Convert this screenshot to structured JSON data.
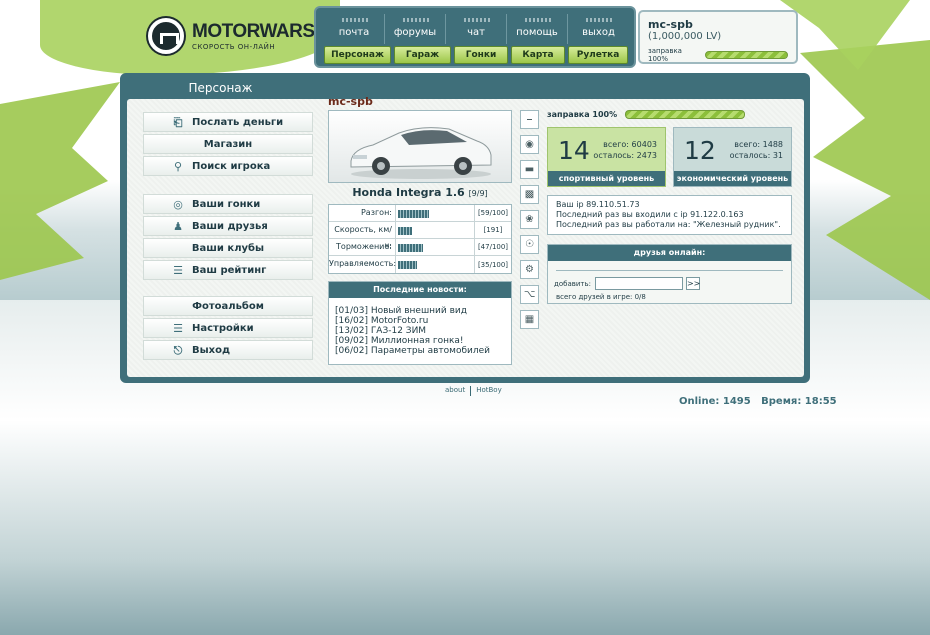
{
  "logo": {
    "title": "MOTORWARS.RU",
    "subtitle": "СКОРОСТЬ ОН-ЛАЙН"
  },
  "nav": {
    "top": [
      "почта",
      "форумы",
      "чат",
      "помощь",
      "выход"
    ],
    "bottom": [
      "Персонаж",
      "Гараж",
      "Гонки",
      "Карта",
      "Рулетка"
    ]
  },
  "user": {
    "name": "mc-spb",
    "lv": "(1,000,000 LV)",
    "fuel_label": "заправка 100%",
    "fuel_pct": 100
  },
  "section_tab": "Персонаж",
  "sidebar": {
    "group1": [
      {
        "label": "Послать деньги",
        "icon": "money-icon"
      },
      {
        "label": "Магазин",
        "icon": ""
      },
      {
        "label": "Поиск игрока",
        "icon": "search-icon"
      }
    ],
    "group2": [
      {
        "label": "Ваши гонки",
        "icon": "steering-wheel-icon"
      },
      {
        "label": "Ваши друзья",
        "icon": "friends-icon"
      },
      {
        "label": "Ваши клубы",
        "icon": ""
      },
      {
        "label": "Ваш рейтинг",
        "icon": "rating-icon"
      }
    ],
    "group3": [
      {
        "label": "Фотоальбом",
        "icon": ""
      },
      {
        "label": "Настройки",
        "icon": "settings-icon"
      },
      {
        "label": "Выход",
        "icon": "exit-icon"
      }
    ]
  },
  "character": {
    "name": "mc-spb"
  },
  "car": {
    "model": "Honda Integra 1.6",
    "slots": "[9/9]",
    "stats": [
      {
        "label": "Разгон:",
        "value": "[59/100]",
        "pct": 59
      },
      {
        "label": "Скорость, км/ч:",
        "value": "[191]",
        "pct": 30
      },
      {
        "label": "Торможение:",
        "value": "[47/100]",
        "pct": 47
      },
      {
        "label": "Управляемость:",
        "value": "[35/100]",
        "pct": 35
      }
    ]
  },
  "news": {
    "title": "Последние новости:",
    "items": [
      "[01/03] Новый внешний вид",
      "[16/02] MotorFoto.ru",
      "[13/02] ГАЗ-12 ЗИМ",
      "[09/02] Миллионная гонка!",
      "[06/02] Параметры автомобилей"
    ]
  },
  "parts": [
    "exhaust-part-icon",
    "tire-part-icon",
    "pipe-part-icon",
    "engine-part-icon",
    "turbo-part-icon",
    "brake-part-icon",
    "gears-part-icon",
    "suspension-part-icon",
    "transmission-part-icon"
  ],
  "fuel": {
    "label": "заправка 100%",
    "pct": 100
  },
  "sport_level": {
    "level": "14",
    "total_label": "всего:",
    "total": "60403",
    "left_label": "осталось:",
    "left": "2473",
    "caption": "спортивный уровень"
  },
  "econ_level": {
    "level": "12",
    "total_label": "всего:",
    "total": "1488",
    "left_label": "осталось:",
    "left": "31",
    "caption": "экономический уровень"
  },
  "ip": {
    "line1": "Ваш ip 89.110.51.73",
    "line2": "Последний раз вы входили с ip 91.122.0.163",
    "line3": "Последний раз вы работали на: \"Железный рудник\"."
  },
  "friends": {
    "title": "друзья онлайн:",
    "add_label": "добавить:",
    "add_value": "",
    "go_label": ">>",
    "total": "всего друзей в игре: 0/8"
  },
  "footer": {
    "about": "about",
    "hotboy": "HotBoy"
  },
  "status": {
    "online": "Online: 1495",
    "time": "Время: 18:55"
  },
  "colors": {
    "accent": "#3f6f7a",
    "green": "#9cc648",
    "leaf": "#a9d25e"
  }
}
